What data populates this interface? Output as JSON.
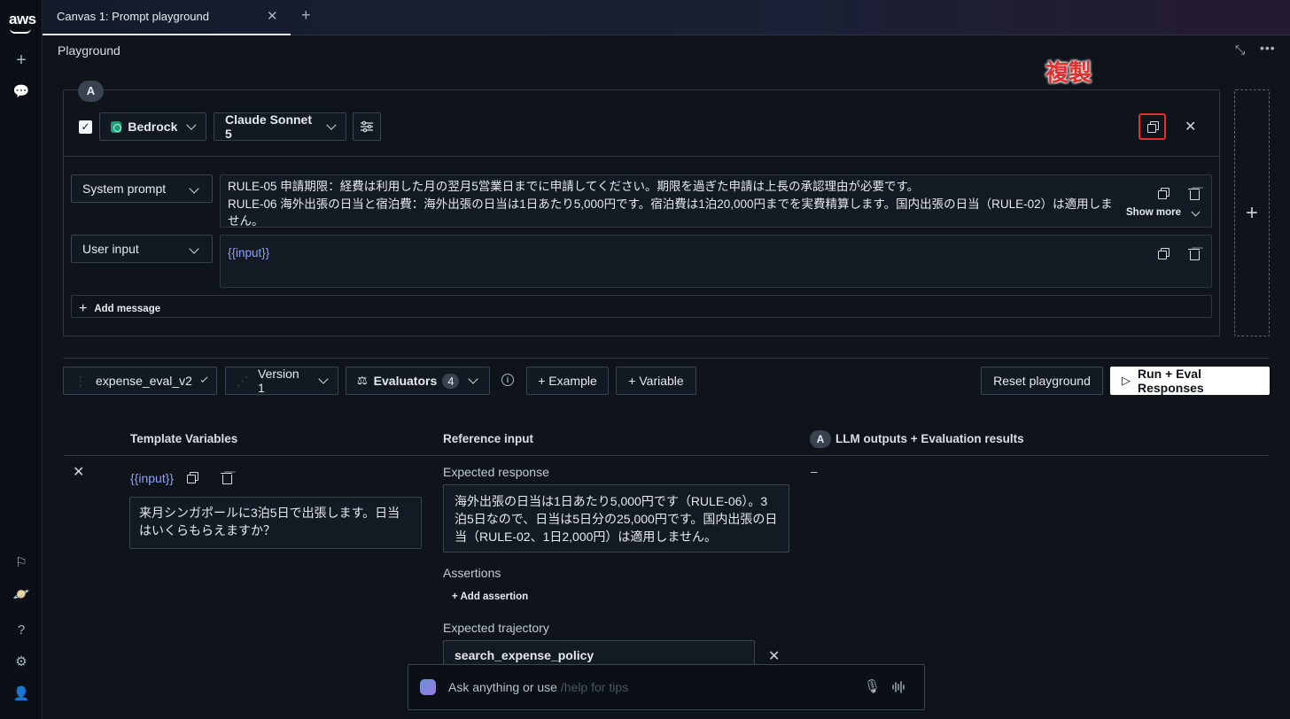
{
  "tab": {
    "label": "Canvas 1: Prompt playground",
    "close": "✕",
    "add": "+"
  },
  "page": {
    "title": "Playground"
  },
  "annotation": {
    "text": "複製"
  },
  "panel": {
    "badge": "A",
    "checkbox": "✓",
    "provider": "Bedrock",
    "model": "Claude Sonnet 5",
    "messages": [
      {
        "role": "System prompt",
        "lines": [
          "RULE-05 申請期限：経費は利用した月の翌月5営業日までに申請してください。期限を過ぎた申請は上長の承認理由が必要です。",
          "RULE-06 海外出張の日当と宿泊費：海外出張の日当は1日あたり5,000円です。宿泊費は1泊20,000円までを実費精算します。国内出張の日当（RULE-02）は適用しません。"
        ],
        "show_more": "Show more"
      },
      {
        "role": "User input",
        "content": "{{input}}"
      }
    ],
    "add_message": "Add message"
  },
  "toolbar": {
    "dataset": "expense_eval_v2",
    "version": "Version 1",
    "evaluators_label": "Evaluators",
    "evaluators_count": "4",
    "add_example": "+ Example",
    "add_variable": "+ Variable",
    "reset": "Reset playground",
    "run": "Run + Eval Responses"
  },
  "table": {
    "col_template": "Template Variables",
    "col_reference": "Reference input",
    "col_outputs_badge": "A",
    "col_outputs": "LLM outputs + Evaluation results",
    "row": {
      "variable": "{{input}}",
      "input_value": "来月シンガポールに3泊5日で出張します。日当はいくらもらえますか？",
      "expected_response_label": "Expected response",
      "expected_response": "海外出張の日当は1日あたり5,000円です（RULE-06）。3泊5日なので、日当は5日分の25,000円です。国内出張の日当（RULE-02、1日2,000円）は適用しません。",
      "assertions_label": "Assertions",
      "add_assertion": "+ Add assertion",
      "trajectory_label": "Expected trajectory",
      "trajectory_value": "search_expense_policy",
      "output": "–"
    }
  },
  "ask": {
    "placeholder": "Ask anything or use",
    "tip": " /help for tips"
  },
  "colors": {
    "accent_red": "#e03030",
    "variable_blue": "#8fa0ff",
    "background": "#0f141b"
  }
}
